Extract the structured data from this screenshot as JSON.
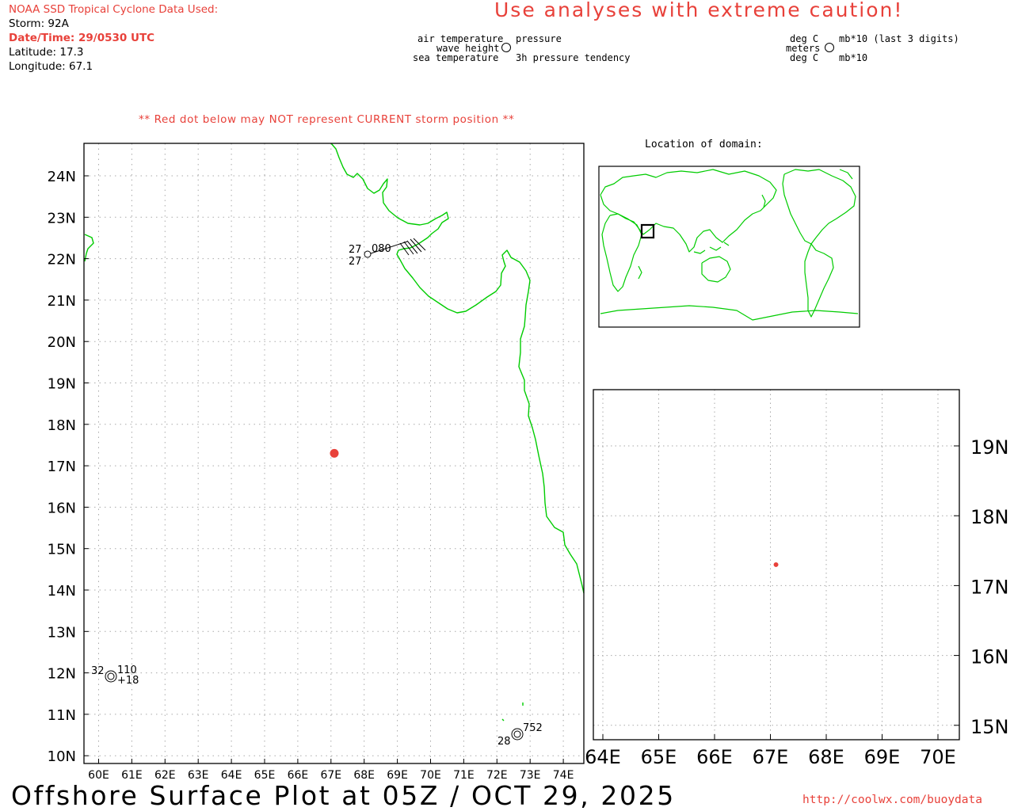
{
  "header": {
    "source_title": "NOAA SSD Tropical Cyclone Data Used:",
    "storm": "Storm: 92A",
    "datetime": "Date/Time: 29/0530 UTC",
    "latitude": "Latitude: 17.3",
    "longitude": "Longitude: 67.1",
    "caution": "Use analyses with extreme caution!",
    "warning": "** Red dot below may NOT represent CURRENT storm position **"
  },
  "legend_station": {
    "air_temperature": "air temperature",
    "wave_height": "wave height",
    "sea_temperature": "sea temperature",
    "pressure": "pressure",
    "pressure_tendency": "3h pressure tendency"
  },
  "legend_units": {
    "air_temp_unit": "deg C",
    "wave_unit": "meters",
    "sea_temp_unit": "deg C",
    "pressure_unit": "mb*10 (last 3 digits)",
    "tendency_unit": "mb*10"
  },
  "main_map": {
    "lon_labels": [
      "60E",
      "61E",
      "62E",
      "63E",
      "64E",
      "65E",
      "66E",
      "67E",
      "68E",
      "69E",
      "70E",
      "71E",
      "72E",
      "73E",
      "74E"
    ],
    "lat_labels": [
      "24N",
      "23N",
      "22N",
      "21N",
      "20N",
      "19N",
      "18N",
      "17N",
      "16N",
      "15N",
      "14N",
      "13N",
      "12N",
      "11N",
      "10N"
    ],
    "storm_position": {
      "lat": 17.3,
      "lon": 67.1
    },
    "stations": [
      {
        "air_temp": "27",
        "sea_temp": "27",
        "pressure": "080",
        "tendency": ""
      },
      {
        "air_temp": "32",
        "sea_temp": "",
        "pressure": "110",
        "tendency": "+18"
      },
      {
        "air_temp": "28",
        "sea_temp": "",
        "pressure": "752",
        "tendency": ""
      }
    ]
  },
  "inset": {
    "title": "Location of domain:"
  },
  "zoom_map": {
    "lon_labels": [
      "64E",
      "65E",
      "66E",
      "67E",
      "68E",
      "69E",
      "70E"
    ],
    "lat_labels": [
      "19N",
      "18N",
      "17N",
      "16N",
      "15N"
    ]
  },
  "footer": {
    "title": "Offshore Surface Plot at 05Z / OCT 29, 2025",
    "url": "http://coolwx.com/buoydata"
  },
  "colors": {
    "accent_red": "#e8413a",
    "coast_green": "#00cc00",
    "grid_gray": "#aaaaaa"
  }
}
